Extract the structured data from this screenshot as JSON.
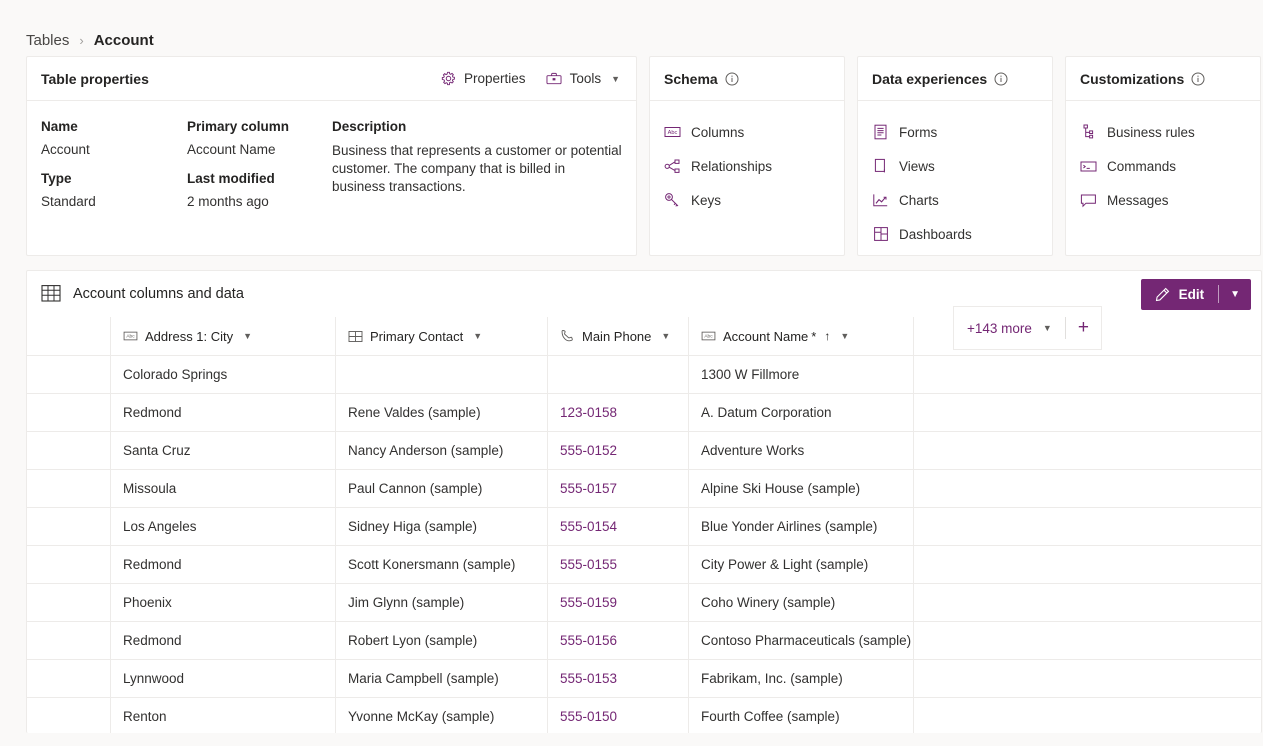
{
  "breadcrumb": {
    "parent": "Tables",
    "separator": "›",
    "current": "Account"
  },
  "colors": {
    "accent": "#742774",
    "link": "#742774",
    "background": "#faf9f8",
    "card": "#ffffff",
    "border": "#edebe9"
  },
  "table_properties": {
    "title": "Table properties",
    "properties_label": "Properties",
    "tools_label": "Tools",
    "fields": [
      {
        "label": "Name",
        "value": "Account"
      },
      {
        "label": "Type",
        "value": "Standard"
      },
      {
        "label": "Primary column",
        "value": "Account Name"
      },
      {
        "label": "Last modified",
        "value": "2 months ago"
      }
    ],
    "description_label": "Description",
    "description_value": "Business that represents a customer or potential customer. The company that is billed in business transactions."
  },
  "schema": {
    "title": "Schema",
    "items": [
      {
        "label": "Columns",
        "icon": "abc-column-icon"
      },
      {
        "label": "Relationships",
        "icon": "relationships-icon"
      },
      {
        "label": "Keys",
        "icon": "key-icon"
      }
    ]
  },
  "data_experiences": {
    "title": "Data experiences",
    "items": [
      {
        "label": "Forms",
        "icon": "form-icon"
      },
      {
        "label": "Views",
        "icon": "view-icon"
      },
      {
        "label": "Charts",
        "icon": "chart-icon"
      },
      {
        "label": "Dashboards",
        "icon": "dashboard-icon"
      }
    ]
  },
  "customizations": {
    "title": "Customizations",
    "items": [
      {
        "label": "Business rules",
        "icon": "business-rules-icon"
      },
      {
        "label": "Commands",
        "icon": "commands-icon"
      },
      {
        "label": "Messages",
        "icon": "messages-icon"
      }
    ]
  },
  "grid": {
    "title": "Account columns and data",
    "edit_label": "Edit",
    "more_columns_label": "+143 more",
    "columns": [
      {
        "label": "Address 1: City",
        "icon": "abc-column-icon",
        "required": false,
        "sorted": false
      },
      {
        "label": "Primary Contact",
        "icon": "lookup-column-icon",
        "required": false,
        "sorted": false
      },
      {
        "label": "Main Phone",
        "icon": "phone-column-icon",
        "required": false,
        "sorted": false
      },
      {
        "label": "Account Name",
        "icon": "abc-column-icon",
        "required": true,
        "sorted": true,
        "sort_direction": "ascending"
      }
    ],
    "rows": [
      {
        "city": "Colorado Springs",
        "contact": "",
        "phone": "",
        "account": "1300 W Fillmore"
      },
      {
        "city": "Redmond",
        "contact": "Rene Valdes (sample)",
        "phone": "123-0158",
        "account": "A. Datum Corporation"
      },
      {
        "city": "Santa Cruz",
        "contact": "Nancy Anderson (sample)",
        "phone": "555-0152",
        "account": "Adventure Works"
      },
      {
        "city": "Missoula",
        "contact": "Paul Cannon (sample)",
        "phone": "555-0157",
        "account": "Alpine Ski House (sample)"
      },
      {
        "city": "Los Angeles",
        "contact": "Sidney Higa (sample)",
        "phone": "555-0154",
        "account": "Blue Yonder Airlines (sample)"
      },
      {
        "city": "Redmond",
        "contact": "Scott Konersmann (sample)",
        "phone": "555-0155",
        "account": "City Power & Light (sample)"
      },
      {
        "city": "Phoenix",
        "contact": "Jim Glynn (sample)",
        "phone": "555-0159",
        "account": "Coho Winery (sample)"
      },
      {
        "city": "Redmond",
        "contact": "Robert Lyon (sample)",
        "phone": "555-0156",
        "account": "Contoso Pharmaceuticals (sample)"
      },
      {
        "city": "Lynnwood",
        "contact": "Maria Campbell (sample)",
        "phone": "555-0153",
        "account": "Fabrikam, Inc. (sample)"
      },
      {
        "city": "Renton",
        "contact": "Yvonne McKay (sample)",
        "phone": "555-0150",
        "account": "Fourth Coffee (sample)"
      }
    ]
  }
}
